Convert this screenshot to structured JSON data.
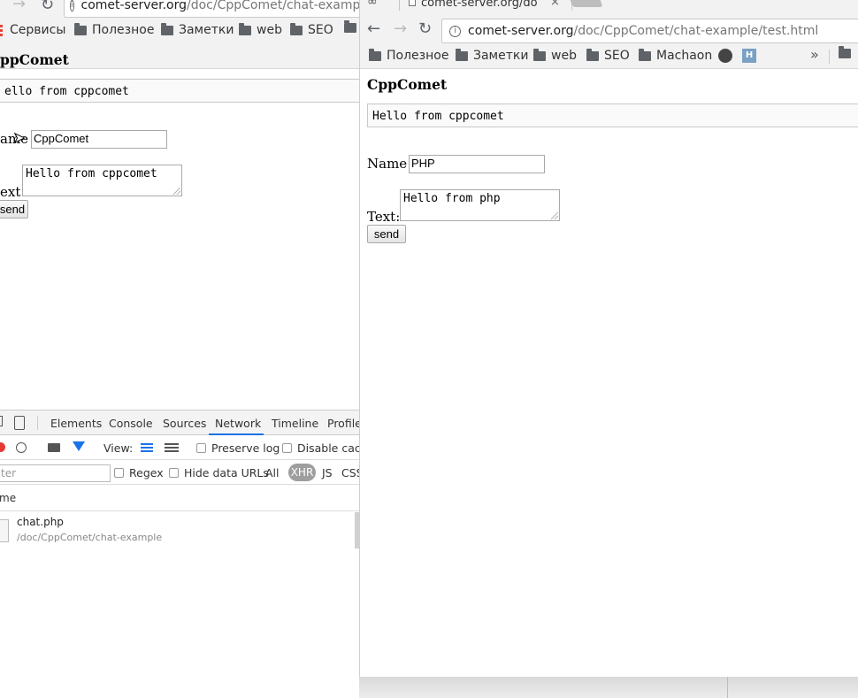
{
  "left_window": {
    "url_host": "comet-server.org",
    "url_path": "/doc/CppComet/chat-example/",
    "bookmarks": [
      "Сервисы",
      "Полезное",
      "Заметки",
      "web",
      "SEO"
    ],
    "page": {
      "title": "ppComet",
      "message": "ello from cppcomet",
      "name_label": "ame :",
      "name_value": "CppComet",
      "text_label": "ext:",
      "text_value": "Hello from cppcomet",
      "send_label": "send"
    },
    "devtools": {
      "tabs": [
        "Elements",
        "Console",
        "Sources",
        "Network",
        "Timeline",
        "Profile"
      ],
      "active_tab": "Network",
      "view_label": "View:",
      "preserve_log": "Preserve log",
      "disable_cache": "Disable cach",
      "filter_placeholder": "ter",
      "regex": "Regex",
      "hide_data_urls": "Hide data URLs",
      "type_filters": [
        "All",
        "XHR",
        "JS",
        "CSS"
      ],
      "active_type": "XHR",
      "column_name": "me",
      "request": {
        "name": "chat.php",
        "path": "/doc/CppComet/chat-example"
      }
    }
  },
  "right_window": {
    "tab_title": "comet-server.org/do",
    "url_host": "comet-server.org",
    "url_path": "/doc/CppComet/chat-example/test.html",
    "bookmarks": [
      "Полезное",
      "Заметки",
      "web",
      "SEO",
      "Machaon"
    ],
    "overflow": "»",
    "page": {
      "title": "CppComet",
      "message": "Hello from cppcomet",
      "name_label": "Name :",
      "name_value": "PHP",
      "text_label": "Text:",
      "text_value": "Hello from php",
      "send_label": "send"
    }
  },
  "colors": {
    "chrome_bg": "#f2f2f2",
    "devtools_active": "#1a73e8",
    "xhr_pill": "#9e9e9e"
  }
}
